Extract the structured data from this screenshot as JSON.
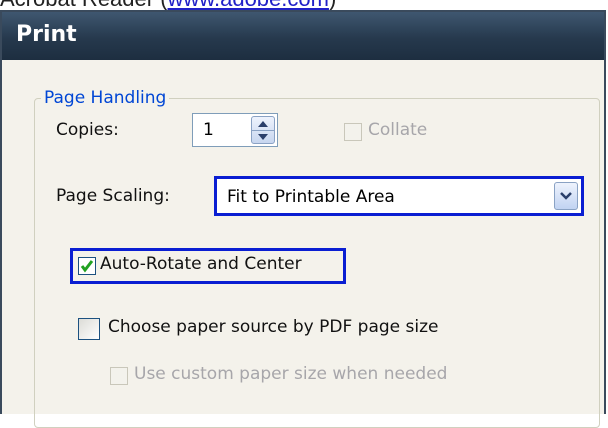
{
  "caption": {
    "text_before": "Acrobat Reader (",
    "link_text": "www.adobe.com",
    "text_after": ")"
  },
  "window": {
    "title": "Print"
  },
  "page_handling": {
    "legend": "Page Handling",
    "copies_label": "Copies:",
    "copies_value": "1",
    "collate_label": "Collate",
    "page_scaling_label": "Page Scaling:",
    "page_scaling_value": "Fit to Printable Area",
    "auto_rotate_label": "Auto-Rotate and Center",
    "auto_rotate_checked": true,
    "choose_paper_label": "Choose paper source by PDF page size",
    "choose_paper_checked": false,
    "custom_paper_label": "Use custom paper size when needed",
    "custom_paper_checked": false
  },
  "colors": {
    "titlebar": "#26394d",
    "highlight": "#0a1ed2",
    "legend": "#0046d5",
    "check": "#21a121"
  },
  "icons": {
    "spin_up": "triangle-up-icon",
    "spin_down": "triangle-down-icon",
    "dropdown": "chevron-down-icon",
    "check": "check-icon"
  }
}
